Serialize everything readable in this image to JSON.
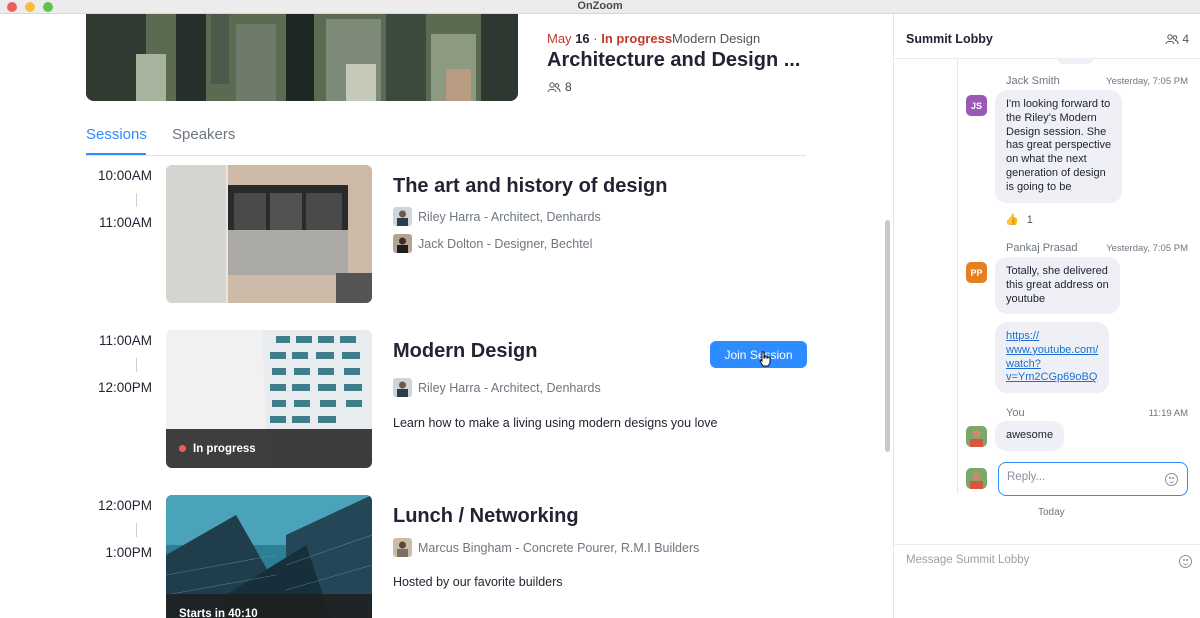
{
  "window": {
    "title": "OnZoom"
  },
  "event": {
    "month": "May",
    "day": "16",
    "separator": "·",
    "status": "In progress",
    "track": "Modern Design",
    "title": "Architecture and Design ...",
    "attendees": "8"
  },
  "tabs": [
    {
      "label": "Sessions",
      "active": true
    },
    {
      "label": "Speakers",
      "active": false
    }
  ],
  "sessions": [
    {
      "start": "10:00AM",
      "end": "11:00AM",
      "title": "The art and history of design",
      "speakers": [
        "Riley Harra - Architect, Denhards",
        "Jack Dolton - Designer, Bechtel"
      ]
    },
    {
      "start": "11:00AM",
      "end": "12:00PM",
      "title": "Modern Design",
      "speakers": [
        "Riley Harra - Architect, Denhards"
      ],
      "description": "Learn how to make a living using modern designs you love",
      "badge": "In progress",
      "action": "Join Session"
    },
    {
      "start": "12:00PM",
      "end": "1:00PM",
      "title": "Lunch / Networking",
      "speakers": [
        "Marcus Bingham - Concrete Pourer, R.M.I Builders"
      ],
      "description": "Hosted by our favorite builders",
      "badge": "Starts in 40:10"
    }
  ],
  "chat": {
    "title": "Summit Lobby",
    "member_count": "4",
    "messages": [
      {
        "sender": "Jack Smith",
        "initials": "JS",
        "avatar_color": "#9b59b6",
        "time": "Yesterday, 7:05 PM",
        "lines": [
          "I'm looking forward to",
          "the Riley's Modern",
          "Design session. She",
          "has great perspective",
          "on what the next",
          "generation of design",
          "is going to be"
        ],
        "reaction_icon": "👍",
        "reaction_count": "1"
      },
      {
        "sender": "Pankaj Prasad",
        "initials": "PP",
        "avatar_color": "#e67e22",
        "time": "Yesterday, 7:05 PM",
        "lines": [
          "Totally, she delivered",
          "this great address on",
          "youtube"
        ],
        "link_lines": [
          "https://",
          "www.youtube.com/",
          "watch?",
          "v=Ym2CGp69oBQ"
        ]
      },
      {
        "sender": "You",
        "time": "11:19 AM",
        "text": "awesome"
      }
    ],
    "reply_placeholder": "Reply...",
    "divider": "Today",
    "composer_placeholder": "Message Summit Lobby"
  }
}
